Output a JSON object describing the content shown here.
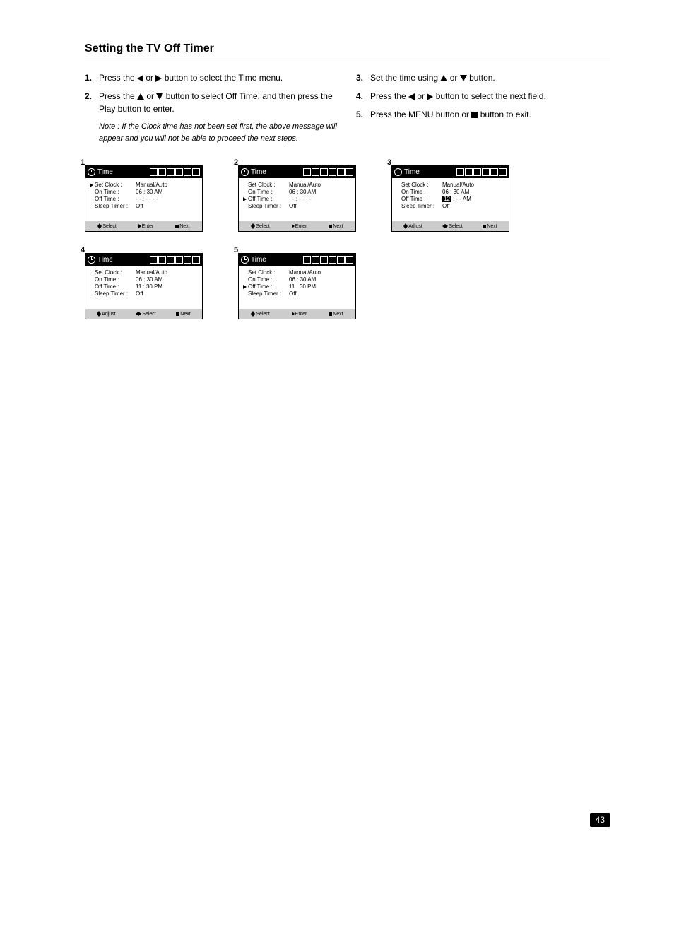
{
  "section_title": "Setting the TV Off Timer",
  "instructions_left": [
    {
      "num": "1.",
      "text_before": "Press the ",
      "icon1": "left",
      "text_mid": " or ",
      "icon2": "right",
      "text_after": " button to select the Time menu."
    },
    {
      "num": "2.",
      "text_before": "Press the ",
      "icon1": "up",
      "text_mid": " or ",
      "icon2": "down",
      "text_after": " button to select Off Time, and then press the Play button to enter."
    },
    {
      "num": "",
      "note": true,
      "text": "Note : If the Clock time has not been set first, the above message will appear and you will not be able to proceed the next steps."
    }
  ],
  "instructions_right": [
    {
      "num": "3.",
      "text_before": "Set the time using ",
      "icon1": "up",
      "text_mid": " or ",
      "icon2": "down",
      "text_after": " button."
    },
    {
      "num": "4.",
      "text_before": "Press the ",
      "icon1": "left",
      "text_mid": " or ",
      "icon2": "right",
      "text_after": " button to select the next field."
    },
    {
      "num": "5.",
      "text_before": "Press the MENU button or ",
      "icon1": "stop",
      "text_mid": "",
      "icon2": "",
      "text_after": " button to exit."
    }
  ],
  "panels": [
    {
      "num": "1",
      "title": "Time",
      "selected": "Set Clock",
      "rows": [
        {
          "label": "Set Clock :",
          "val": "Manual/Auto"
        },
        {
          "label": "On Time :",
          "val": "06 : 30 AM"
        },
        {
          "label": "Off Time :",
          "val": "- - : - -  - -"
        },
        {
          "label": "Sleep Timer :",
          "val": "Off"
        }
      ],
      "footer": [
        {
          "type": "updown",
          "label": "Select"
        },
        {
          "type": "right",
          "label": "Enter"
        },
        {
          "type": "sq",
          "label": "Next"
        }
      ]
    },
    {
      "num": "2",
      "title": "Time",
      "selected": "Off Time",
      "rows": [
        {
          "label": "Set Clock :",
          "val": "Manual/Auto"
        },
        {
          "label": "On Time :",
          "val": "06 : 30  AM"
        },
        {
          "label": "Off Time :",
          "val": "- - : - -  - -"
        },
        {
          "label": "Sleep Timer :",
          "val": "Off"
        }
      ],
      "footer": [
        {
          "type": "updown",
          "label": "Select"
        },
        {
          "type": "right",
          "label": "Enter"
        },
        {
          "type": "sq",
          "label": "Next"
        }
      ]
    },
    {
      "num": "3",
      "title": "Time",
      "selected": "",
      "rows": [
        {
          "label": "Set Clock :",
          "val": "Manual/Auto"
        },
        {
          "label": "On Time :",
          "val": "06 : 30  AM"
        },
        {
          "label": "Off Time :",
          "val_hl_first": "12",
          "val_rest": " : - -  AM"
        },
        {
          "label": "Sleep Timer :",
          "val": "Off"
        }
      ],
      "footer": [
        {
          "type": "updown",
          "label": "Adjust"
        },
        {
          "type": "leftright",
          "label": "Select"
        },
        {
          "type": "sq",
          "label": "Next"
        }
      ]
    },
    {
      "num": "4",
      "title": "Time",
      "selected": "",
      "rows": [
        {
          "label": "Set Clock :",
          "val": "Manual/Auto"
        },
        {
          "label": "On Time :",
          "val": "06 : 30  AM"
        },
        {
          "label": "Off Time :",
          "val": "11 : 30  PM"
        },
        {
          "label": "Sleep Timer :",
          "val": "Off"
        }
      ],
      "footer": [
        {
          "type": "updown",
          "label": "Adjust"
        },
        {
          "type": "leftright",
          "label": "Select"
        },
        {
          "type": "sq",
          "label": "Next"
        }
      ]
    },
    {
      "num": "5",
      "title": "Time",
      "selected": "Off Time",
      "rows": [
        {
          "label": "Set Clock :",
          "val": "Manual/Auto"
        },
        {
          "label": "On Time :",
          "val": "06 : 30  AM"
        },
        {
          "label": "Off Time :",
          "val": "11 : 30  PM"
        },
        {
          "label": "Sleep Timer :",
          "val": "Off"
        }
      ],
      "footer": [
        {
          "type": "updown",
          "label": "Select"
        },
        {
          "type": "right",
          "label": "Enter"
        },
        {
          "type": "sq",
          "label": "Next"
        }
      ]
    }
  ],
  "page_number": "43"
}
